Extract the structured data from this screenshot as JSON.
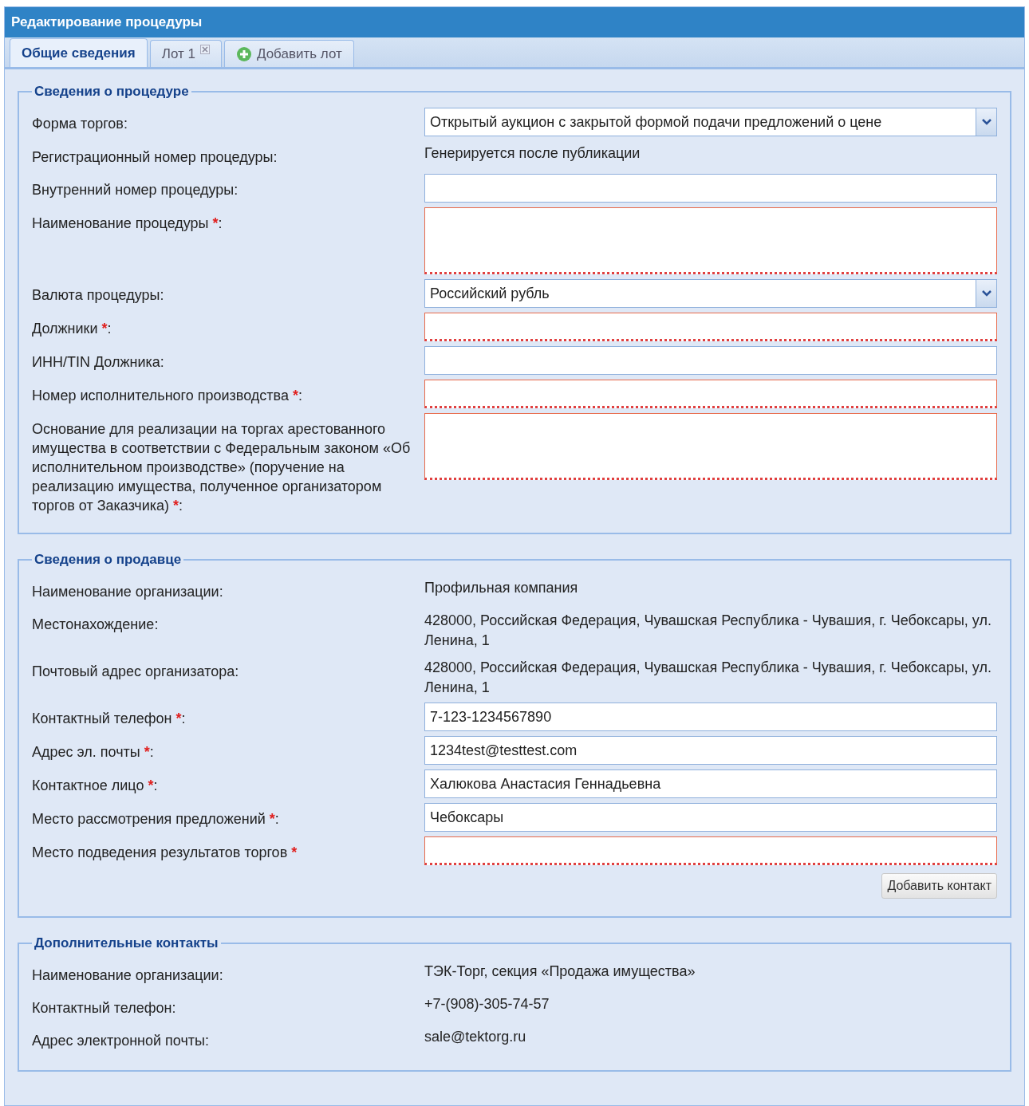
{
  "window": {
    "title": "Редактирование процедуры"
  },
  "tabs": [
    {
      "kind": "text",
      "label": "Общие сведения",
      "selected": true
    },
    {
      "kind": "closable",
      "label": "Лот 1",
      "selected": false
    },
    {
      "kind": "add",
      "label": "Добавить лот",
      "selected": false
    }
  ],
  "sections": [
    {
      "title": "Сведения о процедуре",
      "rows": [
        {
          "label": "Форма торгов:",
          "kind": "select",
          "value": "Открытый аукцион с закрытой формой подачи предложений о цене"
        },
        {
          "label": "Регистрационный номер процедуры:",
          "kind": "static",
          "value": "Генерируется после публикации"
        },
        {
          "label": "Внутренний номер процедуры:",
          "kind": "input",
          "invalid": false
        },
        {
          "label": "Наименование процедуры",
          "mark": "*",
          "tail": ":",
          "kind": "textarea",
          "invalid": true
        },
        {
          "label": "Валюта процедуры:",
          "kind": "select",
          "value": "Российский рубль"
        },
        {
          "label": "Должники",
          "mark": "*",
          "tail": ":",
          "kind": "input",
          "invalid": true
        },
        {
          "label": "ИНН/TIN Должника:",
          "kind": "input",
          "invalid": false
        },
        {
          "label": "Номер исполнительного производства",
          "mark": "*",
          "tail": ":",
          "kind": "input",
          "invalid": true
        },
        {
          "label": "Основание для реализации на торгах арестованного имущества в соответствии с Федеральным законом «Об исполнительном производстве» (поручение на реализацию имущества, полученное организатором торгов от Заказчика)",
          "mark": "*",
          "tail": ":",
          "kind": "textarea",
          "invalid": true
        }
      ]
    },
    {
      "title": "Сведения о продавце",
      "rows": [
        {
          "label": "Наименование организации:",
          "kind": "static",
          "value": "Профильная компания"
        },
        {
          "label": "Местонахождение:",
          "kind": "static",
          "value": "428000, Российская Федерация, Чувашская Республика - Чувашия, г. Чебоксары, ул. Ленина, 1"
        },
        {
          "label": "Почтовый адрес организатора:",
          "kind": "static",
          "value": "428000, Российская Федерация, Чувашская Республика - Чувашия, г. Чебоксары, ул. Ленина, 1"
        },
        {
          "label": "Контактный телефон",
          "mark": "*",
          "tail": ":",
          "kind": "input",
          "invalid": false,
          "value": "7-123-1234567890"
        },
        {
          "label": "Адрес эл. почты",
          "mark": "*",
          "tail": ":",
          "kind": "input",
          "invalid": false,
          "value": "1234test@testtest.com"
        },
        {
          "label": "Контактное лицо",
          "mark": "*",
          "tail": ":",
          "kind": "input",
          "invalid": false,
          "value": "Халюкова Анастасия Геннадьевна"
        },
        {
          "label": "Место рассмотрения предложений",
          "mark": "*",
          "tail": ":",
          "kind": "input",
          "invalid": false,
          "value": "Чебоксары"
        },
        {
          "label": "Место подведения результатов торгов",
          "mark": "*",
          "kind": "input",
          "invalid": true
        }
      ],
      "button": "Добавить контакт"
    },
    {
      "title": "Дополнительные контакты",
      "rows": [
        {
          "label": "Наименование организации:",
          "kind": "static",
          "value": "ТЭК-Торг, секция «Продажа имущества»"
        },
        {
          "label": "Контактный телефон:",
          "kind": "static",
          "value": "+7-(908)-305-74-57"
        },
        {
          "label": "Адрес электронной почты:",
          "kind": "static",
          "value": "sale@tektorg.ru"
        }
      ]
    }
  ]
}
